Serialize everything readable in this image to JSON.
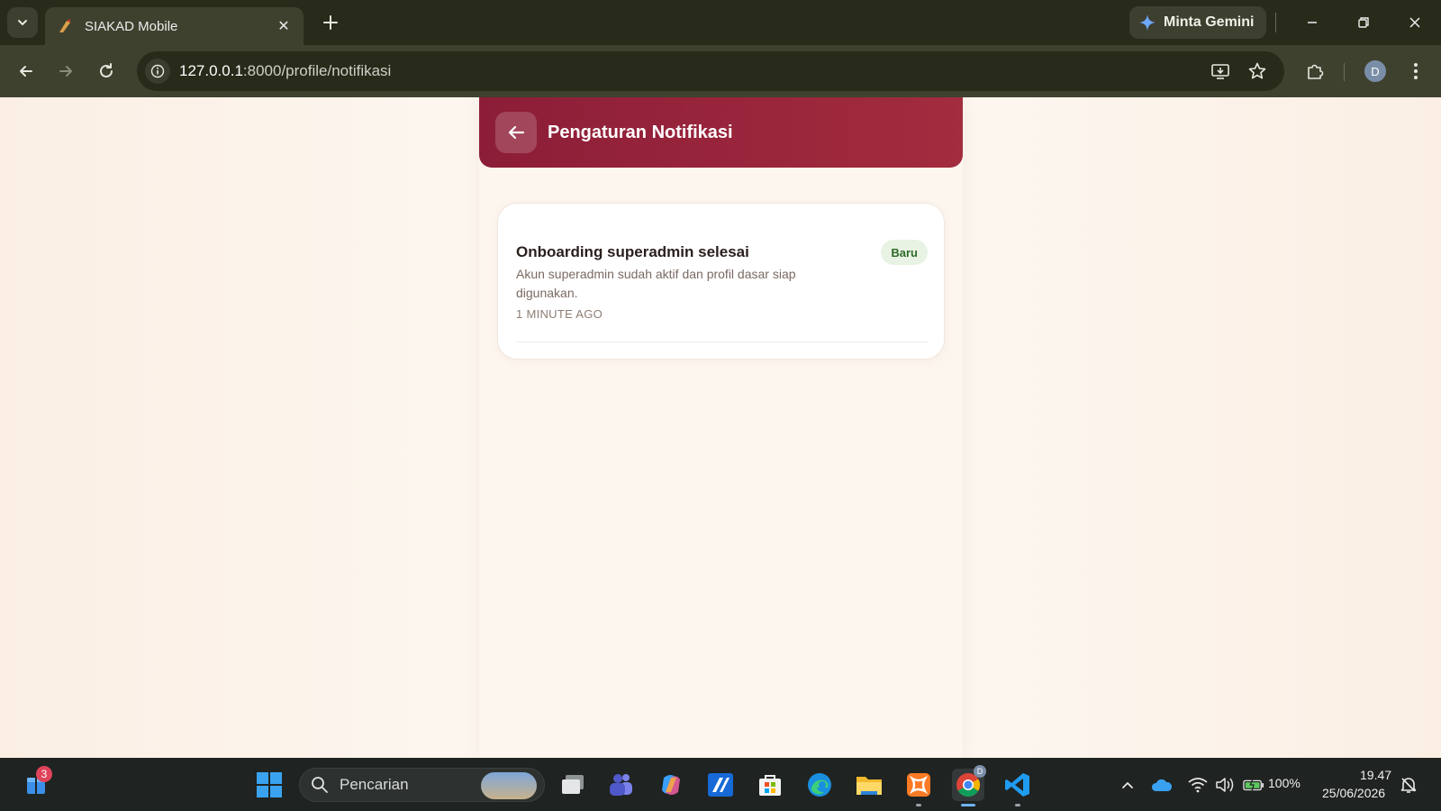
{
  "browser": {
    "tab_title": "SIAKAD Mobile",
    "gemini_label": "Minta Gemini",
    "url_host": "127.0.0.1",
    "url_rest": ":8000/profile/notifikasi",
    "profile_initial": "D"
  },
  "app": {
    "header_title": "Pengaturan Notifikasi",
    "notifications": [
      {
        "title": "Onboarding superadmin selesai",
        "body": "Akun superadmin sudah aktif dan profil dasar siap digunakan.",
        "time": "1 MINUTE AGO",
        "badge": "Baru"
      }
    ]
  },
  "taskbar": {
    "widgets_badge": "3",
    "search_placeholder": "Pencarian",
    "chrome_badge": "D",
    "battery": "100%",
    "time": "19.47",
    "date": "25/06/2026"
  },
  "colors": {
    "header_start": "#8c1d38",
    "header_end": "#a32c3e",
    "badge_bg": "#e8f3e4",
    "badge_text": "#2e6b2a"
  }
}
